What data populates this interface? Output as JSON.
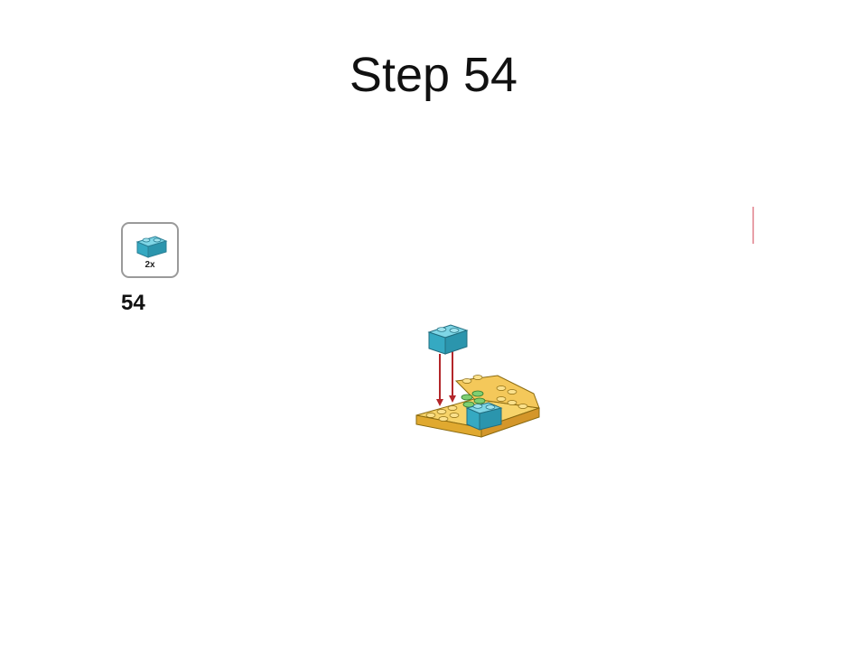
{
  "slide": {
    "title": "Step 54"
  },
  "step": {
    "number": "54",
    "parts_quantity": "2x",
    "part_color": "#3fb8d0",
    "base_color": "#f2c44a",
    "arrow_color": "#b3262a",
    "highlight_color": "#6cc46a",
    "part_icon": "blue-2x1-brick-icon"
  }
}
